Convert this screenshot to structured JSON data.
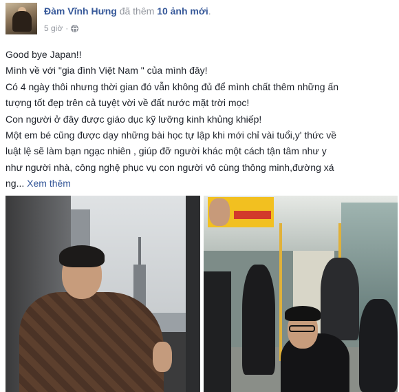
{
  "post": {
    "author": "Đàm Vĩnh Hưng",
    "action_prefix": " đã thêm ",
    "action_count": "10 ảnh mới",
    "action_suffix": ".",
    "timestamp": "5 giờ",
    "separator": "·",
    "privacy_icon": "globe-icon",
    "lines": [
      "Good bye Japan!!",
      "Mình về với \"gia đình Việt Nam \" của mình đây!",
      "Có 4 ngày thôi nhưng thời gian đó vẫn không đủ để mình chất thêm những ấn",
      "tượng tốt đẹp trên cả tuyệt vời về đất nước mặt trời mọc!",
      "Con người ở đây được giáo dục kỹ lưỡng kinh khủng khiếp!",
      "Một em bé cũng được dạy những bài học tự lập khi mới chỉ vài tuổi,y' thức về",
      "luật lệ sẽ làm bạn ngạc nhiên , giúp đỡ người khác một cách tận tâm như y",
      "như người nhà, công nghệ phục vụ con người vô cùng thông minh,đường xá",
      "ng..."
    ],
    "see_more": "Xem thêm"
  },
  "colors": {
    "link": "#365899",
    "meta": "#90949c",
    "text": "#1d2129"
  }
}
